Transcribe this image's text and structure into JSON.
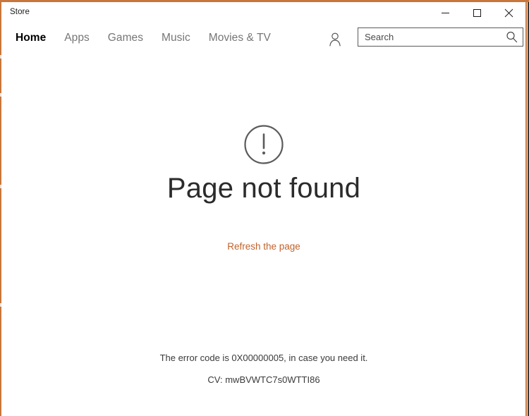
{
  "window": {
    "title": "Store",
    "accent_color": "#c8763b",
    "controls": [
      {
        "name": "minimize",
        "label": "—"
      },
      {
        "name": "maximize",
        "label": "□"
      },
      {
        "name": "close",
        "label": "✕"
      }
    ]
  },
  "nav": {
    "items": [
      {
        "label": "Home",
        "selected": true
      },
      {
        "label": "Apps",
        "selected": false
      },
      {
        "label": "Games",
        "selected": false
      },
      {
        "label": "Music",
        "selected": false
      },
      {
        "label": "Movies & TV",
        "selected": false
      }
    ],
    "account_icon": "person-icon"
  },
  "search": {
    "value": "",
    "placeholder": "Search",
    "icon": "search-icon"
  },
  "error_page": {
    "icon": "exclamation-circle-icon",
    "title": "Page not found",
    "refresh_label": "Refresh the page",
    "error_code_text": "The error code is 0X00000005, in case you need it.",
    "cv_text": "CV: mwBVWTC7s0WTTI86",
    "link_color": "#c1622c"
  }
}
